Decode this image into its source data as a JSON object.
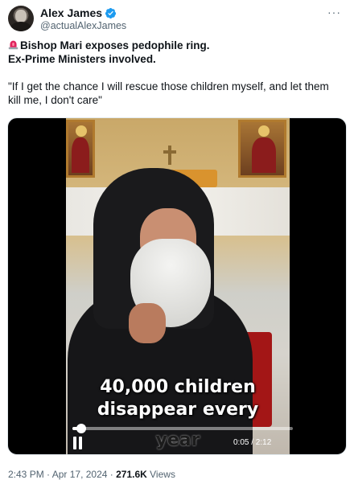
{
  "author": {
    "display_name": "Alex James",
    "handle": "@actualAlexJames",
    "verified": true,
    "avatar_icon": "avatar-photo",
    "verified_color": "#1d9bf0"
  },
  "menu": {
    "more_label": "···"
  },
  "tweet": {
    "siren_icon": "police-siren-emoji",
    "line1": "Bishop Mari exposes pedophile ring.",
    "line2": "Ex-Prime Ministers involved.",
    "quote": "\"If I get the chance I will rescue those children myself, and let them kill me, I don't care\""
  },
  "video": {
    "caption_line1": "40,000 children",
    "caption_line2": "disappear every",
    "caption_line3": "year",
    "time": "0:05 / 2:12",
    "progress": 0.04,
    "state": "playing",
    "control_icon": "pause-icon"
  },
  "meta": {
    "time": "2:43 PM",
    "separator1": " · ",
    "date": "Apr 17, 2024",
    "separator2": " · ",
    "views_count": "271.6K",
    "views_label": " Views"
  }
}
